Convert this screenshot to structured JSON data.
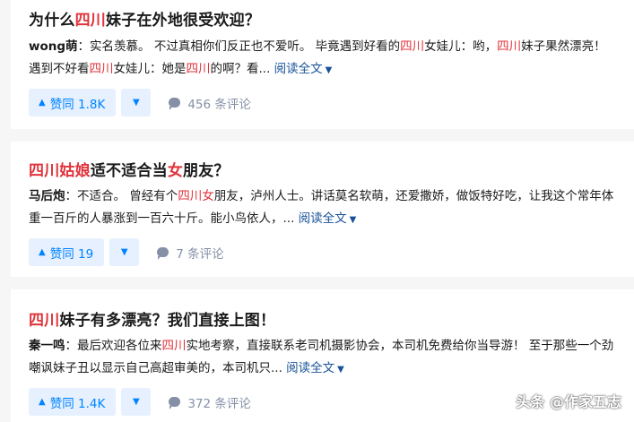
{
  "colors": {
    "highlight": "#e0333b",
    "link": "#175199",
    "vote": "#0084ff",
    "vote_bg": "#e6f0ff",
    "muted": "#8590a6"
  },
  "answers": [
    {
      "title_parts": [
        "为什么",
        "四川",
        "妹子在外地很受欢迎？"
      ],
      "author": "wong萌",
      "excerpt_parts": [
        "：实名羡慕。 不过真相你们反正也不爱听。 毕竟遇到好看的",
        "四川",
        "女娃儿：哟，",
        "四川",
        "妹子果然漂亮！ 遇到不好看",
        "四川",
        "女娃儿：她是",
        "四川",
        "的啊？看..."
      ],
      "read_more": "阅读全文",
      "vote_label": "赞同 1.8K",
      "comments": "456 条评论"
    },
    {
      "title_parts": [
        "四川姑娘",
        "适不适合当",
        "女",
        "朋友？"
      ],
      "author": "马后炮",
      "excerpt_parts": [
        "：不适合。 曾经有个",
        "四川女",
        "朋友，泸州人士。讲话莫名软萌，还爱撒娇，做饭特好吃，让我这个常年体重一百斤的人暴涨到一百六十斤。能小鸟依人，..."
      ],
      "read_more": "阅读全文",
      "vote_label": "赞同 19",
      "comments": "7 条评论"
    },
    {
      "title_parts": [
        "四川",
        "妹子有多漂亮？我们直接上图！"
      ],
      "author": "秦一鸣",
      "excerpt_parts": [
        "：最后欢迎各位来",
        "四川",
        "实地考察，直接联系老司机摄影协会，本司机免费给你当导游！ 至于那些一个劲嘲讽妹子丑以显示自己高超审美的，本司机只..."
      ],
      "read_more": "阅读全文",
      "vote_label": "赞同 1.4K",
      "comments": "372 条评论"
    }
  ],
  "icons": {
    "vote_up": "triangle-up-icon",
    "vote_down": "triangle-down-icon",
    "comment": "comment-bubble-icon",
    "expand": "chevron-down-icon"
  },
  "watermark": "头条 @作家五志"
}
